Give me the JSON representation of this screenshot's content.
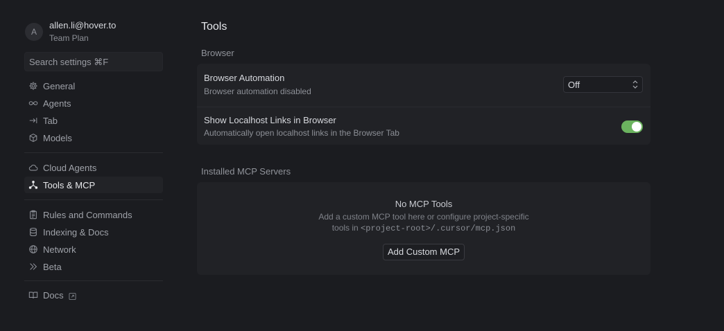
{
  "account": {
    "avatar_letter": "A",
    "email": "allen.li@hover.to",
    "plan": "Team Plan"
  },
  "search": {
    "placeholder": "Search settings ⌘F"
  },
  "sidebar": {
    "items": [
      {
        "label": "General",
        "icon": "gear-icon"
      },
      {
        "label": "Agents",
        "icon": "infinity-icon"
      },
      {
        "label": "Tab",
        "icon": "tab-arrow-icon"
      },
      {
        "label": "Models",
        "icon": "cube-icon"
      },
      {
        "label": "Cloud Agents",
        "icon": "cloud-icon"
      },
      {
        "label": "Tools & MCP",
        "icon": "tools-network-icon",
        "active": true
      },
      {
        "label": "Rules and Commands",
        "icon": "clipboard-icon"
      },
      {
        "label": "Indexing & Docs",
        "icon": "database-icon"
      },
      {
        "label": "Network",
        "icon": "globe-icon"
      },
      {
        "label": "Beta",
        "icon": "chevrons-right-icon"
      },
      {
        "label": "Docs",
        "icon": "book-icon",
        "external_icon": "external-link-icon"
      }
    ]
  },
  "main": {
    "title": "Tools",
    "browser_section": {
      "label": "Browser",
      "automation": {
        "title": "Browser Automation",
        "subtitle": "Browser automation disabled",
        "select_value": "Off"
      },
      "localhost": {
        "title": "Show Localhost Links in Browser",
        "subtitle": "Automatically open localhost links in the Browser Tab",
        "enabled": true
      }
    },
    "mcp_section": {
      "label": "Installed MCP Servers",
      "empty_title": "No MCP Tools",
      "empty_desc_line1": "Add a custom MCP tool here or configure project-specific",
      "empty_desc_prefix": "tools in ",
      "empty_desc_code": "<project-root>/.cursor/mcp.json",
      "add_button": "Add Custom MCP"
    }
  },
  "colors": {
    "background": "#1b1c20",
    "card": "#212226",
    "toggle_on": "#6bb35f"
  }
}
